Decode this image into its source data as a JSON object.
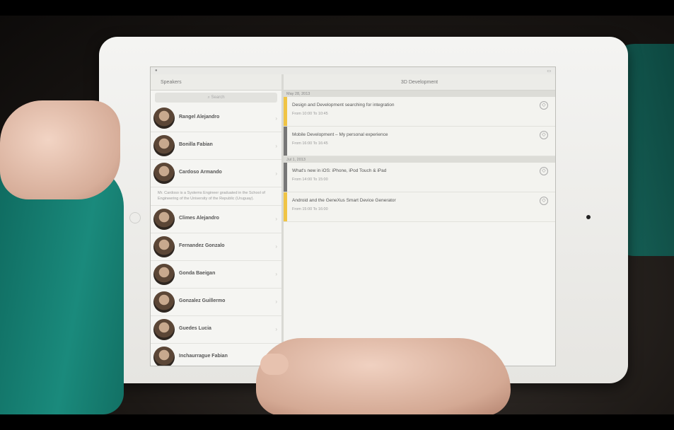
{
  "master": {
    "back_label": "",
    "title": "Speakers",
    "search_placeholder": "Search"
  },
  "speakers": [
    {
      "name": "Rangel Alejandro",
      "sub": ""
    },
    {
      "name": "Bonilla Fabian",
      "sub": ""
    },
    {
      "name": "Cardoso Armando",
      "sub": ""
    },
    {
      "name": "Climes Alejandro",
      "sub": ""
    },
    {
      "name": "Fernandez Gonzalo",
      "sub": ""
    },
    {
      "name": "Gonda Baeigan",
      "sub": ""
    },
    {
      "name": "Gonzalez Guillermo",
      "sub": ""
    },
    {
      "name": "Guedes Lucia",
      "sub": ""
    },
    {
      "name": "Inchaurrague Fabian",
      "sub": ""
    }
  ],
  "bio": "Mr. Cardoso is a Systems Engineer graduated in the School of Engineering of the University of the Republic (Uruguay).",
  "detail": {
    "back_label": "",
    "title": "3D Development"
  },
  "days": [
    {
      "label": "May 28, 2013"
    },
    {
      "label": "Jul 1, 2013"
    }
  ],
  "sessions": [
    {
      "category": "",
      "title": "Design and Development searching for integration",
      "time": "From 10:00  To 10:45",
      "color": "#f0c445"
    },
    {
      "category": "",
      "title": "Mobile Development – My personal experience",
      "time": "From 16:00  To 16:45",
      "color": "#777777"
    },
    {
      "category": "",
      "title": "What's new in iOS: iPhone, iPod Touch & iPad",
      "time": "From 14:00  To 15:00",
      "color": "#777777"
    },
    {
      "category": "",
      "title": "Android and the GeneXus Smart Device Generator",
      "time": "From 15:00  To 16:00",
      "color": "#f0c445"
    }
  ]
}
